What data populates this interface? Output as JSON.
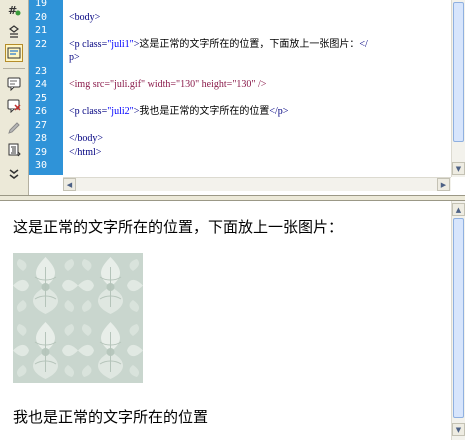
{
  "toolbar": {
    "buttons": [
      {
        "icon": "hash-icon"
      },
      {
        "icon": "snippet-icon"
      },
      {
        "icon": "wrap-tag-icon",
        "active": true
      },
      {
        "icon": "comment-icon"
      },
      {
        "icon": "remove-comment-icon"
      },
      {
        "icon": "pencil-icon"
      },
      {
        "icon": "format-source-icon"
      },
      {
        "icon": "expand-icon"
      }
    ]
  },
  "code": {
    "gutter_color": "#2f93d8",
    "lines": [
      {
        "num": "19",
        "text": ""
      },
      {
        "num": "20",
        "text": "<body>",
        "cls": "navy"
      },
      {
        "num": "21",
        "text": ""
      },
      {
        "num": "22",
        "parts": [
          {
            "t": "<p class=",
            "c": "navy"
          },
          {
            "t": "\"juli1\"",
            "c": "str"
          },
          {
            "t": ">",
            "c": "navy"
          },
          {
            "t": "这是正常的文字所在的位置，下面放上一张图片：",
            "c": "txt"
          },
          {
            "t": "</",
            "c": "navy"
          }
        ]
      },
      {
        "num": "",
        "text": "p>",
        "cls": "navy"
      },
      {
        "num": "23",
        "text": ""
      },
      {
        "num": "24",
        "text": "<img src=\"juli.gif\" width=\"130\" height=\"130\" />",
        "cls": "purple"
      },
      {
        "num": "25",
        "text": ""
      },
      {
        "num": "26",
        "parts": [
          {
            "t": "<p class=",
            "c": "navy"
          },
          {
            "t": "\"juli2\"",
            "c": "str"
          },
          {
            "t": ">",
            "c": "navy"
          },
          {
            "t": "我也是正常的文字所在的位置",
            "c": "txt"
          },
          {
            "t": "</p>",
            "c": "navy"
          }
        ]
      },
      {
        "num": "27",
        "text": ""
      },
      {
        "num": "28",
        "text": "</body>",
        "cls": "navy"
      },
      {
        "num": "29",
        "text": "</html>",
        "cls": "navy"
      },
      {
        "num": "30",
        "text": ""
      }
    ]
  },
  "design": {
    "paragraph1": "这是正常的文字所在的位置，下面放上一张图片：",
    "paragraph2": "我也是正常的文字所在的位置",
    "image": {
      "src": "juli.gif",
      "width": 130,
      "height": 130
    }
  }
}
